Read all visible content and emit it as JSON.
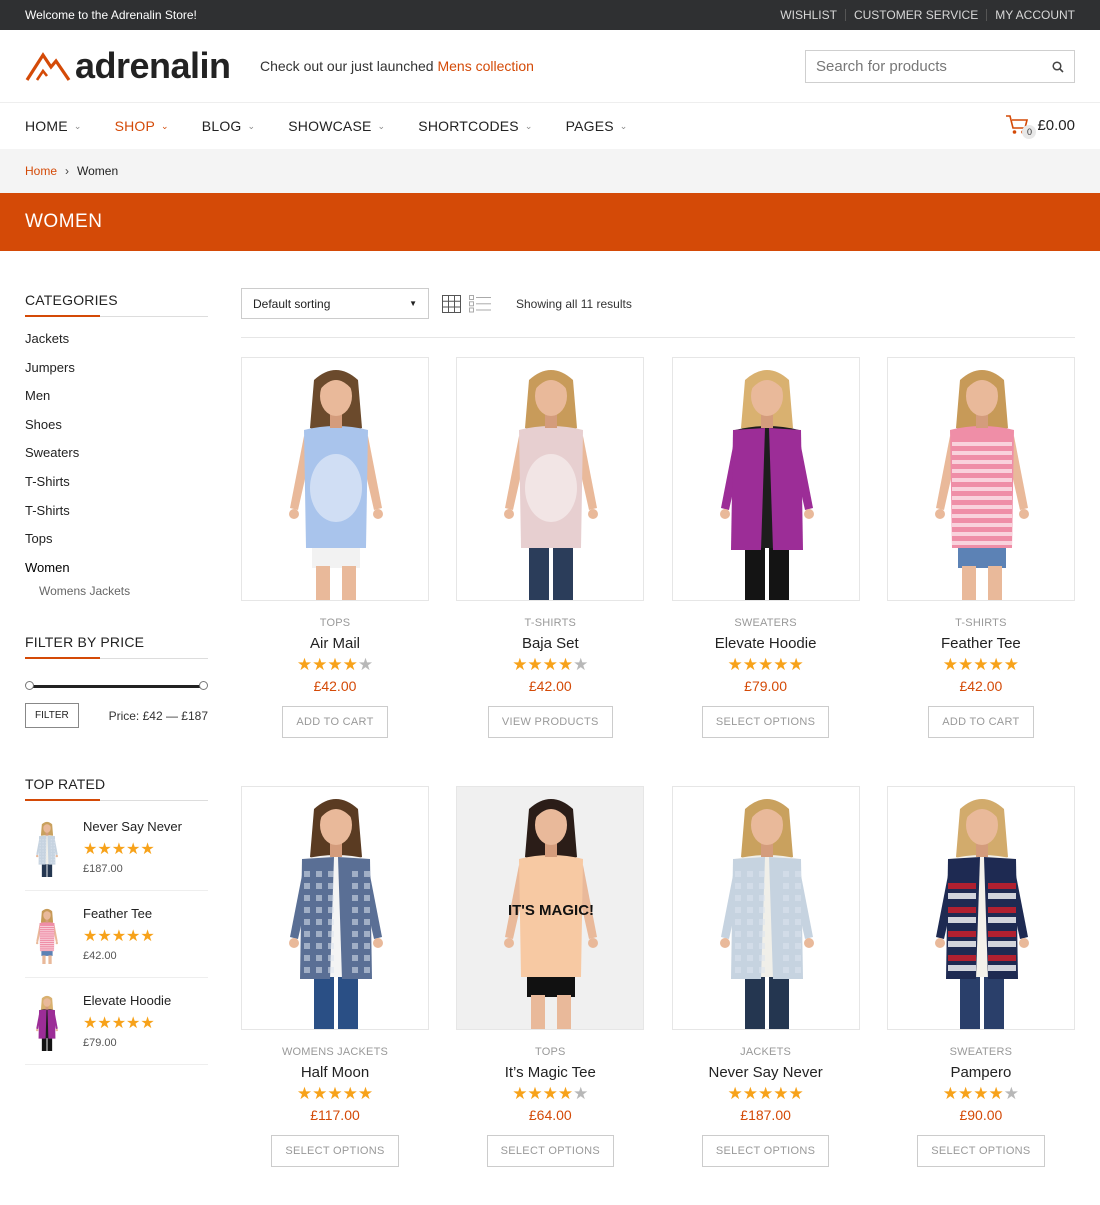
{
  "topbar": {
    "welcome": "Welcome to the Adrenalin Store!",
    "links": [
      "WISHLIST",
      "CUSTOMER SERVICE",
      "MY ACCOUNT"
    ]
  },
  "header": {
    "logo_text": "adrenalin",
    "promo_text": "Check out our just launched ",
    "promo_link": "Mens collection",
    "search_placeholder": "Search for products"
  },
  "nav": {
    "items": [
      "HOME",
      "SHOP",
      "BLOG",
      "SHOWCASE",
      "SHORTCODES",
      "PAGES"
    ],
    "active": "SHOP",
    "cart_count": "0",
    "cart_total": "£0.00"
  },
  "breadcrumb": {
    "home": "Home",
    "current": "Women"
  },
  "banner_title": "WOMEN",
  "sidebar": {
    "categories_title": "CATEGORIES",
    "categories": [
      "Jackets",
      "Jumpers",
      "Men",
      "Shoes",
      "Sweaters",
      "T-Shirts",
      "T-Shirts",
      "Tops",
      "Women"
    ],
    "subcategory": "Womens Jackets",
    "price_title": "FILTER BY PRICE",
    "filter_label": "FILTER",
    "price_label": "Price: £42 — £187",
    "top_rated_title": "TOP RATED",
    "top_rated": [
      {
        "name": "Never Say Never",
        "stars": "★★★★★",
        "price": "£187.00"
      },
      {
        "name": "Feather Tee",
        "stars": "★★★★★",
        "price": "£42.00"
      },
      {
        "name": "Elevate Hoodie",
        "stars": "★★★★★",
        "price": "£79.00"
      }
    ]
  },
  "toolbar": {
    "sort_label": "Default sorting",
    "results_text": "Showing all 11 results"
  },
  "products": [
    {
      "category": "TOPS",
      "title": "Air Mail",
      "rating": 4.5,
      "price": "£42.00",
      "button": "ADD TO CART"
    },
    {
      "category": "T-SHIRTS",
      "title": "Baja Set",
      "rating": 4.5,
      "price": "£42.00",
      "button": "VIEW PRODUCTS"
    },
    {
      "category": "SWEATERS",
      "title": "Elevate Hoodie",
      "rating": 5,
      "price": "£79.00",
      "button": "SELECT OPTIONS"
    },
    {
      "category": "T-SHIRTS",
      "title": "Feather Tee",
      "rating": 5,
      "price": "£42.00",
      "button": "ADD TO CART"
    },
    {
      "category": "WOMENS JACKETS",
      "title": "Half Moon",
      "rating": 5,
      "price": "£117.00",
      "button": "SELECT OPTIONS"
    },
    {
      "category": "TOPS",
      "title": "It’s Magic Tee",
      "rating": 4.5,
      "price": "£64.00",
      "button": "SELECT OPTIONS"
    },
    {
      "category": "JACKETS",
      "title": "Never Say Never",
      "rating": 5,
      "price": "£187.00",
      "button": "SELECT OPTIONS"
    },
    {
      "category": "SWEATERS",
      "title": "Pampero",
      "rating": 4.5,
      "price": "£90.00",
      "button": "SELECT OPTIONS"
    }
  ],
  "product_print_text": "IT'S MAGIC!",
  "colors": {
    "accent": "#d44a07",
    "topbar": "#2f3032",
    "star": "#f7a21a"
  }
}
